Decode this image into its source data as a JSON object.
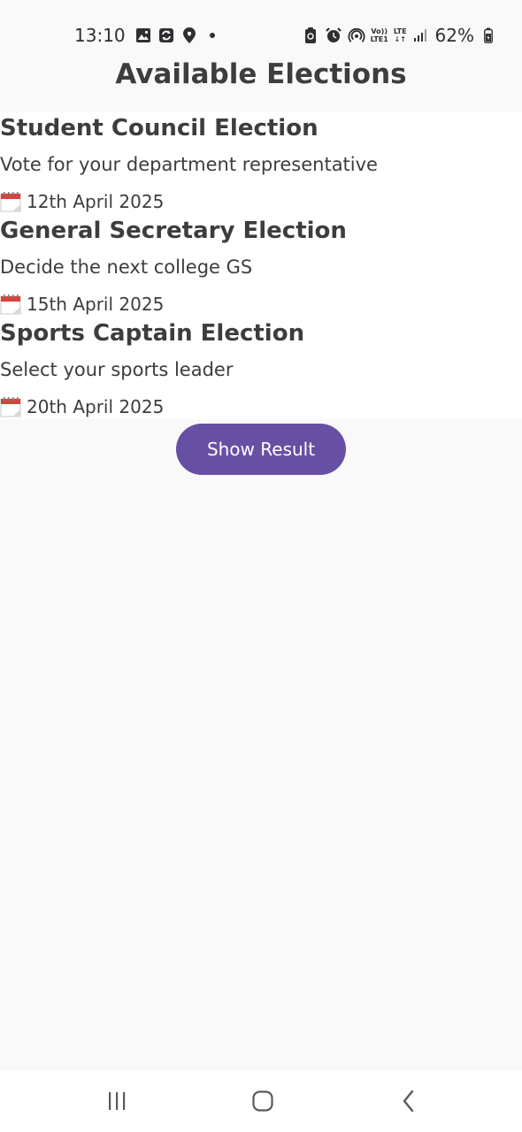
{
  "status_bar": {
    "time": "13:10",
    "left_icons": [
      "gallery-icon",
      "sync-icon",
      "location-pin-icon",
      "dot-icon"
    ],
    "right_icons": [
      "battery-saver-icon",
      "alarm-icon",
      "hotspot-icon",
      "volte-icon",
      "lte-icon",
      "signal-icon"
    ],
    "volte_top": "Vo))",
    "volte_bottom": "LTE1",
    "lte_top": "LTE",
    "lte_bottom": "↓↑",
    "battery": "62%"
  },
  "header": {
    "title": "Available Elections"
  },
  "elections": [
    {
      "title": "Student Council Election",
      "description": "Vote for your department representative",
      "date": "12th April 2025"
    },
    {
      "title": "General Secretary Election",
      "description": "Decide the next college GS",
      "date": "15th April 2025"
    },
    {
      "title": "Sports Captain Election",
      "description": "Select your sports leader",
      "date": "20th April 2025"
    }
  ],
  "actions": {
    "show_result_label": "Show Result"
  },
  "colors": {
    "primary": "#6750a4",
    "background": "#f9f9f9",
    "card": "#ffffff",
    "text": "#3d3d40"
  },
  "nav_bar": {
    "items": [
      "recent-apps-icon",
      "home-icon",
      "back-icon"
    ]
  }
}
